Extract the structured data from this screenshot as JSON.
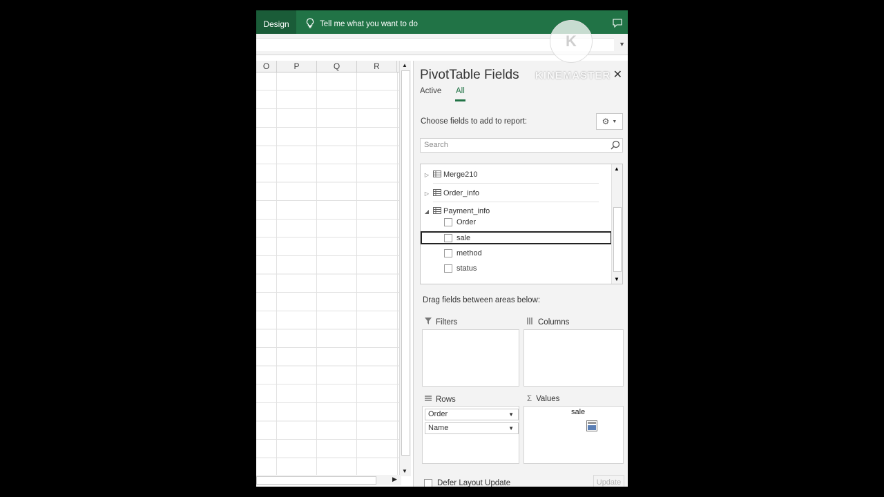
{
  "ribbon": {
    "design_tab": "Design",
    "tell_me": "Tell me what you want to do"
  },
  "grid": {
    "columns": [
      "O",
      "P",
      "Q",
      "R"
    ]
  },
  "pivot": {
    "title": "PivotTable Fields",
    "tabs": [
      "Active",
      "All"
    ],
    "active_tab": "All",
    "choose_label": "Choose fields to add to report:",
    "search_placeholder": "Search",
    "tables": [
      "Merge210",
      "Order_info",
      "Payment_info"
    ],
    "expanded_table": "Payment_info",
    "fields": [
      {
        "label": "Order",
        "checked": false
      },
      {
        "label": "sale",
        "checked": false,
        "selected": true
      },
      {
        "label": "method",
        "checked": false
      },
      {
        "label": "status",
        "checked": false
      }
    ],
    "drag_label": "Drag fields between areas below:",
    "areas": {
      "filters": "Filters",
      "columns": "Columns",
      "rows": "Rows",
      "values": "Values"
    },
    "rows_fields": [
      "Order",
      "Name"
    ],
    "values_dragging": "sale",
    "defer_label": "Defer Layout Update",
    "update_label": "Update"
  },
  "watermark": "KINEMASTER",
  "colors": {
    "ribbon_green": "#217346",
    "pane_bg": "#f3f3f3"
  }
}
